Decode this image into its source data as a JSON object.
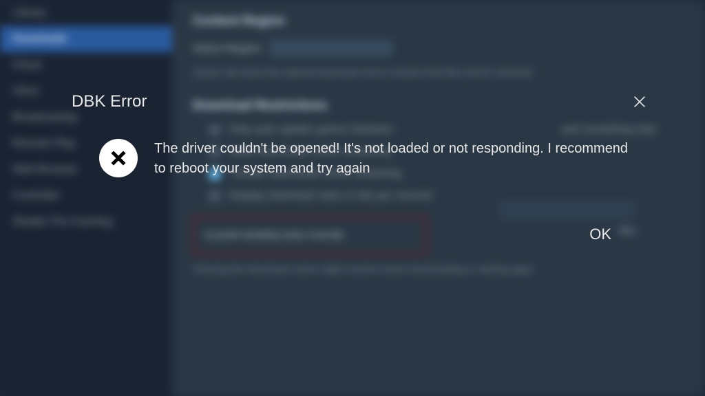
{
  "dialog": {
    "title": "DBK Error",
    "message": "The driver couldn't be opened! It's not loaded or not responding. I recommend to reboot your system and try again",
    "ok_label": "OK"
  },
  "background": {
    "sidebar_items": [
      {
        "label": "Library",
        "active": false
      },
      {
        "label": "Downloads",
        "active": true
      },
      {
        "label": "Cloud",
        "active": false
      },
      {
        "label": "Voice",
        "active": false
      },
      {
        "label": "Broadcasting",
        "active": false
      },
      {
        "label": "Remote Play",
        "active": false
      },
      {
        "label": "Web Browser",
        "active": false
      },
      {
        "label": "Controller",
        "active": false
      },
      {
        "label": "Shader Pre-Caching",
        "active": false
      }
    ],
    "heading1": "Content Region",
    "label1": "Select Region",
    "desc1": "Steam will select the optimal download server location that files will be retrieved",
    "heading2": "Download Restrictions",
    "check1_label": "Only auto-update games between",
    "check2_label": "and something else",
    "check2b_label": "Allow downloads while streaming",
    "check3_label": "Throttle downloads while streaming",
    "check4_label": "Display download rates in bits per second",
    "button_row_label": "CLEAR DOWNLOAD CACHE",
    "bottom_desc": "Clearing the download cache might resolve issues downloading or starting apps",
    "right_label": "kB/s"
  }
}
